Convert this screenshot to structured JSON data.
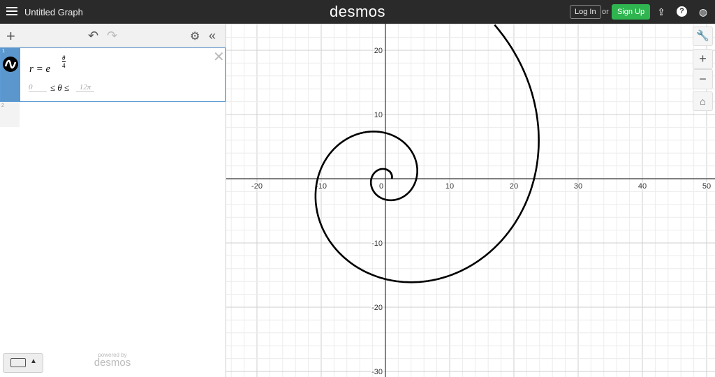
{
  "header": {
    "title": "Untitled Graph",
    "logo": "desmos",
    "login": "Log In",
    "or": "or",
    "signup": "Sign Up",
    "icons": [
      "menu-icon",
      "share-icon",
      "help-icon",
      "globe-icon"
    ]
  },
  "sidebar": {
    "expressions": [
      {
        "index": "1",
        "lhs": "r = e",
        "exp_num": "θ",
        "exp_den": "4",
        "domain_min": "0",
        "domain_var": "≤ θ ≤",
        "domain_max": "12π"
      },
      {
        "index": "2"
      }
    ],
    "powered_by": "powered by",
    "powered_logo": "desmos"
  },
  "graph": {
    "x_ticks": [
      "-20",
      "-10",
      "0",
      "10",
      "20",
      "30",
      "40",
      "50"
    ],
    "y_ticks": [
      "20",
      "10",
      "-10",
      "-20",
      "-30"
    ],
    "curve": {
      "type": "polar",
      "expr": "r=e^(θ/4)",
      "theta_min": 0,
      "theta_max": 37.699,
      "color": "#000000"
    },
    "x_range": [
      -24,
      52
    ],
    "y_range": [
      -31,
      24
    ]
  }
}
